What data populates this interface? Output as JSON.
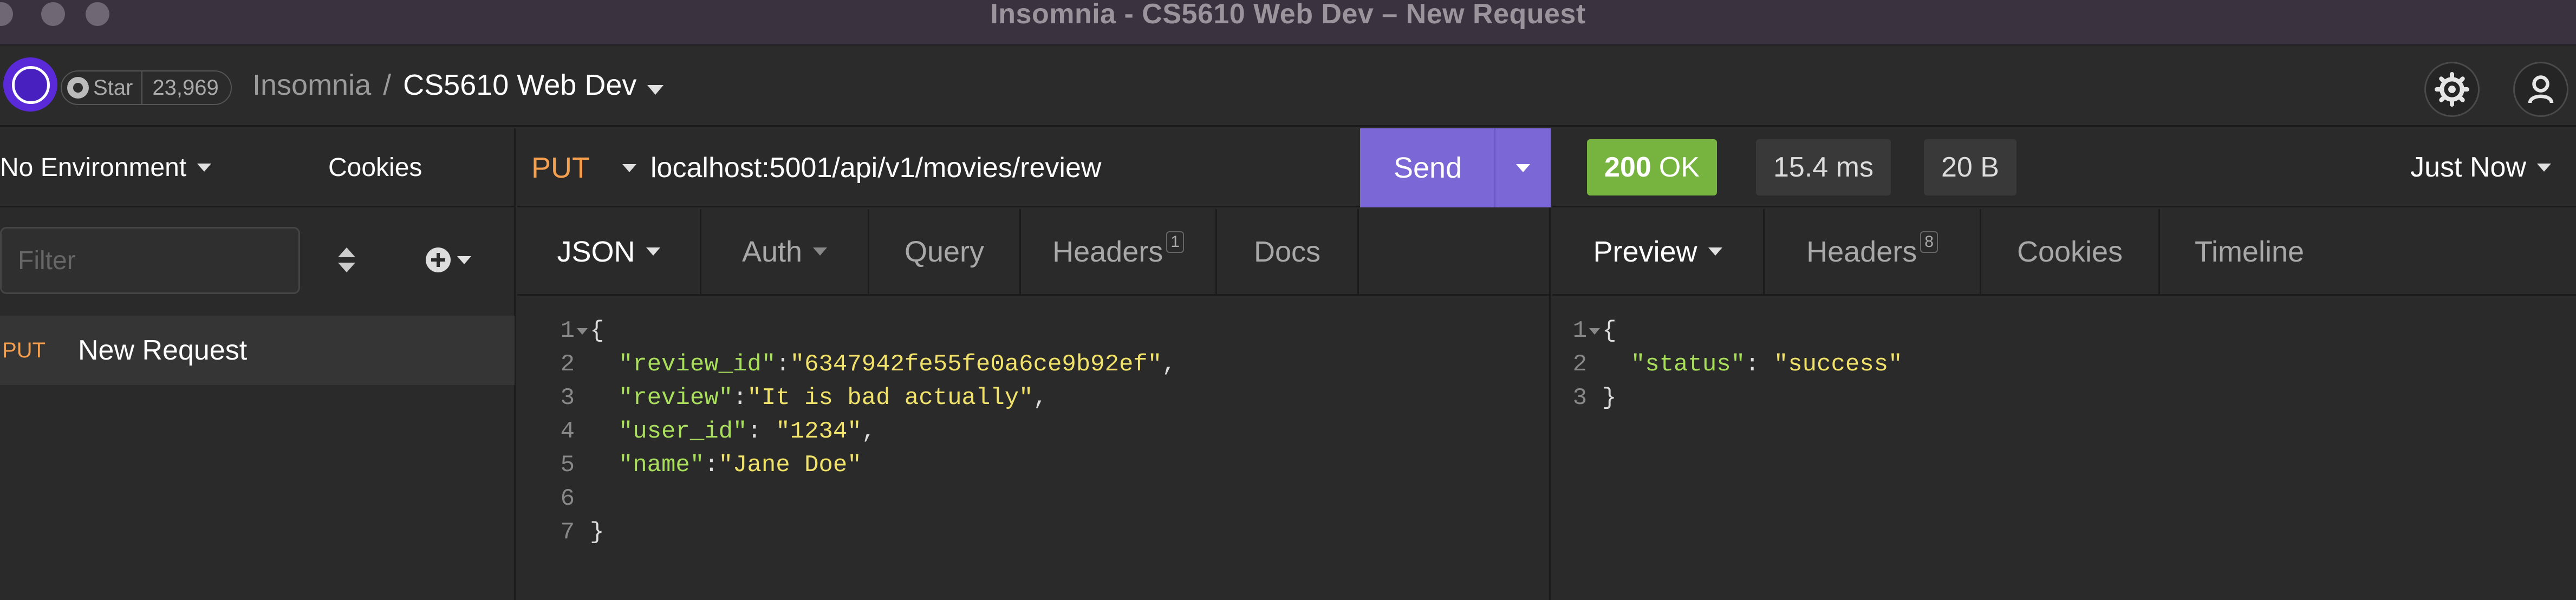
{
  "window": {
    "title": "Insomnia - CS5610 Web Dev – New Request"
  },
  "header": {
    "github": {
      "star_label": "Star",
      "star_count": "23,969"
    },
    "breadcrumb": {
      "app": "Insomnia",
      "separator": "/",
      "project": "CS5610 Web Dev"
    }
  },
  "sidebar": {
    "environment": "No Environment",
    "cookies_label": "Cookies",
    "filter_placeholder": "Filter",
    "requests": [
      {
        "method": "PUT",
        "name": "New Request"
      }
    ]
  },
  "request": {
    "method": "PUT",
    "url": "localhost:5001/api/v1/movies/review",
    "send_label": "Send",
    "tabs": [
      {
        "label": "JSON"
      },
      {
        "label": "Auth"
      },
      {
        "label": "Query"
      },
      {
        "label": "Headers",
        "badge": "1"
      },
      {
        "label": "Docs"
      }
    ],
    "body_lines": [
      {
        "n": "1",
        "text": "{"
      },
      {
        "n": "2",
        "key": "\"review_id\"",
        "sep": ":",
        "value": "\"6347942fe55fe0a6ce9b92ef\"",
        "tail": ","
      },
      {
        "n": "3",
        "key": "\"review\"",
        "sep": ":",
        "value": "\"It is bad actually\"",
        "tail": ","
      },
      {
        "n": "4",
        "key": "\"user_id\"",
        "sep": ": ",
        "value": "\"1234\"",
        "tail": ","
      },
      {
        "n": "5",
        "key": "\"name\"",
        "sep": ":",
        "value": "\"Jane Doe\"",
        "tail": ""
      },
      {
        "n": "6",
        "text": ""
      },
      {
        "n": "7",
        "text": "}"
      }
    ]
  },
  "response": {
    "status_code": "200",
    "status_text": "OK",
    "time": "15.4 ms",
    "size": "20 B",
    "time_selector": "Just Now",
    "tabs": [
      {
        "label": "Preview"
      },
      {
        "label": "Headers",
        "badge": "8"
      },
      {
        "label": "Cookies"
      },
      {
        "label": "Timeline"
      }
    ],
    "body_lines": [
      {
        "n": "1",
        "text": "{"
      },
      {
        "n": "2",
        "key": "\"status\"",
        "sep": ": ",
        "value": "\"success\"",
        "tail": ""
      },
      {
        "n": "3",
        "text": "}"
      }
    ]
  },
  "colors": {
    "accent_send": "#7b68d6",
    "status_ok": "#77b43f",
    "method_put": "#f5a050",
    "json_key": "#a9df5c",
    "json_string": "#f0e26a"
  }
}
